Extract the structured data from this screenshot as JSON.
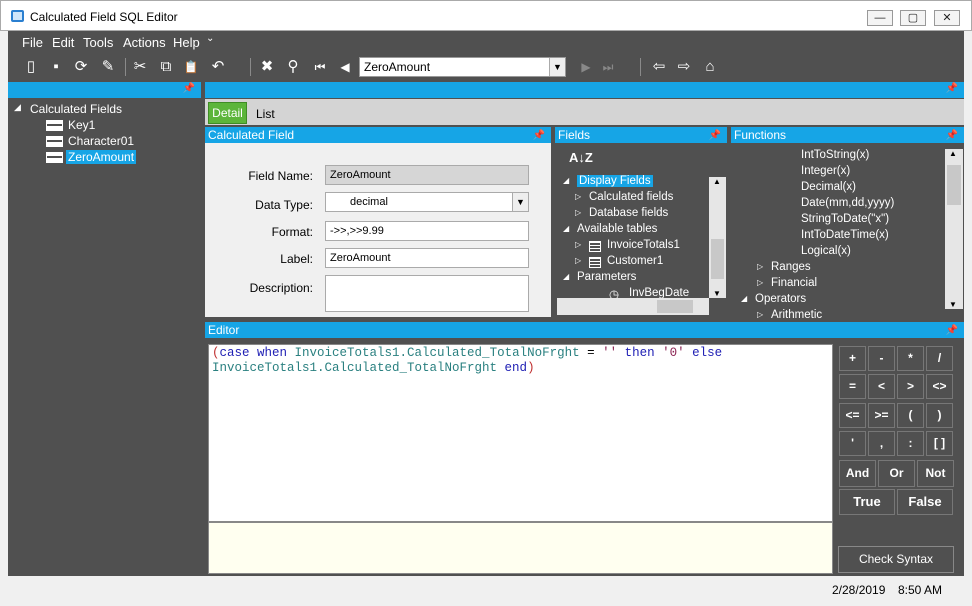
{
  "window": {
    "title": "Calculated Field SQL Editor",
    "min": "—",
    "max": "▢",
    "close": "✕"
  },
  "menu": [
    "File",
    "Edit",
    "Tools",
    "Actions",
    "Help"
  ],
  "menu_more": "⌄",
  "toolbar": {
    "icons": [
      "new-icon",
      "save-icon",
      "refresh-icon",
      "clear-icon",
      "cut-icon",
      "copy-icon",
      "paste-icon",
      "undo-icon",
      "delete-icon",
      "find-icon",
      "first-icon",
      "prev-icon",
      "next-icon",
      "last-icon",
      "back-icon",
      "forward-icon",
      "home-icon"
    ],
    "glyphs": {
      "new": "▯",
      "save": "▪",
      "refresh": "⟳",
      "clear": "✎",
      "cut": "✂",
      "copy": "⧉",
      "paste": "📋",
      "undo": "↶",
      "delete": "✖",
      "find": "⚲",
      "first": "⏮",
      "prev": "◀",
      "next": "▶",
      "last": "⏭",
      "back": "⇦",
      "forward": "⇨",
      "home": "⌂"
    },
    "record_value": "ZeroAmount"
  },
  "tree": {
    "root": "Calculated Fields",
    "items": [
      "Key1",
      "Character01",
      "ZeroAmount"
    ],
    "selected": "ZeroAmount"
  },
  "tabs": {
    "detail": "Detail",
    "list": "List"
  },
  "calculated_field": {
    "header": "Calculated Field",
    "field_name_label": "Field Name:",
    "field_name": "ZeroAmount",
    "data_type_label": "Data Type:",
    "data_type": "decimal",
    "format_label": "Format:",
    "format": "->>,>>9.99",
    "label_label": "Label:",
    "label": "ZeroAmount",
    "description_label": "Description:",
    "description": ""
  },
  "fields": {
    "header": "Fields",
    "sort_glyph": "A↓Z",
    "items": [
      {
        "text": "Display Fields",
        "level": 0,
        "arrow": "◢",
        "selected": true
      },
      {
        "text": "Calculated fields",
        "level": 1,
        "arrow": "▷"
      },
      {
        "text": "Database fields",
        "level": 1,
        "arrow": "▷"
      },
      {
        "text": "Available tables",
        "level": 0,
        "arrow": "◢"
      },
      {
        "text": "InvoiceTotals1",
        "level": 1,
        "arrow": "▷",
        "table": true
      },
      {
        "text": "Customer1",
        "level": 1,
        "arrow": "▷",
        "table": true
      },
      {
        "text": "Parameters",
        "level": 0,
        "arrow": "◢"
      },
      {
        "text": "InvBegDate",
        "level": 2,
        "arrow": "",
        "clock": true
      }
    ]
  },
  "functions": {
    "header": "Functions",
    "items": [
      {
        "text": "IntToString(x)",
        "level": 2,
        "arrow": ""
      },
      {
        "text": "Integer(x)",
        "level": 2,
        "arrow": ""
      },
      {
        "text": "Decimal(x)",
        "level": 2,
        "arrow": ""
      },
      {
        "text": "Date(mm,dd,yyyy)",
        "level": 2,
        "arrow": ""
      },
      {
        "text": "StringToDate(\"x\")",
        "level": 2,
        "arrow": ""
      },
      {
        "text": "IntToDateTime(x)",
        "level": 2,
        "arrow": ""
      },
      {
        "text": "Logical(x)",
        "level": 2,
        "arrow": ""
      },
      {
        "text": "Ranges",
        "level": 1,
        "arrow": "▷"
      },
      {
        "text": "Financial",
        "level": 1,
        "arrow": "▷"
      },
      {
        "text": "Operators",
        "level": 0,
        "arrow": "◢"
      },
      {
        "text": "Arithmetic",
        "level": 1,
        "arrow": "▷"
      }
    ]
  },
  "editor": {
    "header": "Editor",
    "line1": [
      {
        "t": "(",
        "c": "#c03030"
      },
      {
        "t": "case when ",
        "c": "#1e1eb4"
      },
      {
        "t": "InvoiceTotals1.Calculated_TotalNoFrght",
        "c": "#2a8080"
      },
      {
        "t": " = ",
        "c": "#000000"
      },
      {
        "t": "''",
        "c": "#8b2252"
      },
      {
        "t": " then ",
        "c": "#1e1eb4"
      },
      {
        "t": "'0'",
        "c": "#8b2252"
      },
      {
        "t": " else",
        "c": "#1e1eb4"
      }
    ],
    "line2": [
      {
        "t": "InvoiceTotals1.Calculated_TotalNoFrght",
        "c": "#2a8080"
      },
      {
        "t": " end",
        "c": "#1e1eb4"
      },
      {
        "t": ")",
        "c": "#c03030"
      }
    ]
  },
  "keypad": {
    "rows": [
      [
        "+",
        "-",
        "*",
        "/"
      ],
      [
        "=",
        "<",
        ">",
        "<>"
      ],
      [
        "<=",
        ">=",
        "(",
        ")"
      ],
      [
        "'",
        ",",
        ":",
        "[ ]"
      ]
    ],
    "logic": [
      "And",
      "Or",
      "Not"
    ],
    "bool": [
      "True",
      "False"
    ],
    "check_syntax": "Check Syntax"
  },
  "status": {
    "date": "2/28/2019",
    "time": "8:50 AM"
  }
}
